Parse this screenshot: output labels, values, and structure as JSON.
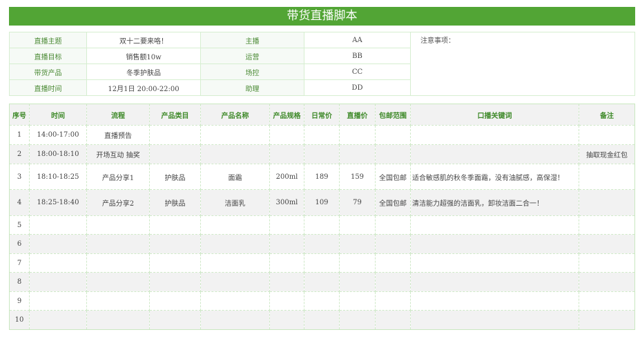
{
  "title": "带货直播脚本",
  "info": {
    "rows": [
      {
        "label": "直播主题",
        "value": "双十二要来咯！",
        "role": "主播",
        "person": "AA"
      },
      {
        "label": "直播目标",
        "value": "销售额10w",
        "role": "运营",
        "person": "BB"
      },
      {
        "label": "带货产品",
        "value": "冬季护肤品",
        "role": "场控",
        "person": "CC"
      },
      {
        "label": "直播时间",
        "value": "12月1日 20:00-22:00",
        "role": "助理",
        "person": "DD"
      }
    ],
    "notes_label": "注意事项："
  },
  "table": {
    "headers": [
      "序号",
      "时间",
      "流程",
      "产品类目",
      "产品名称",
      "产品规格",
      "日常价",
      "直播价",
      "包邮范围",
      "口播关键词",
      "备注"
    ],
    "rows": [
      [
        "1",
        "14:00-17:00",
        "直播预告",
        "",
        "",
        "",
        "",
        "",
        "",
        "",
        ""
      ],
      [
        "2",
        "18:00-18:10",
        "开场互动 抽奖",
        "",
        "",
        "",
        "",
        "",
        "",
        "",
        "抽取现金红包"
      ],
      [
        "3",
        "18:10-18:25",
        "产品分享1",
        "护肤品",
        "面霜",
        "200ml",
        "189",
        "159",
        "全国包邮",
        "适合敏感肌的秋冬季面霜，没有油腻感，高保湿！",
        ""
      ],
      [
        "4",
        "18:25-18:40",
        "产品分享2",
        "护肤品",
        "洁面乳",
        "300ml",
        "109",
        "79",
        "全国包邮",
        "清洁能力超强的洁面乳，卸妆洁面二合一！",
        ""
      ],
      [
        "5",
        "",
        "",
        "",
        "",
        "",
        "",
        "",
        "",
        "",
        ""
      ],
      [
        "6",
        "",
        "",
        "",
        "",
        "",
        "",
        "",
        "",
        "",
        ""
      ],
      [
        "7",
        "",
        "",
        "",
        "",
        "",
        "",
        "",
        "",
        "",
        ""
      ],
      [
        "8",
        "",
        "",
        "",
        "",
        "",
        "",
        "",
        "",
        "",
        ""
      ],
      [
        "9",
        "",
        "",
        "",
        "",
        "",
        "",
        "",
        "",
        "",
        ""
      ],
      [
        "10",
        "",
        "",
        "",
        "",
        "",
        "",
        "",
        "",
        "",
        ""
      ]
    ]
  }
}
